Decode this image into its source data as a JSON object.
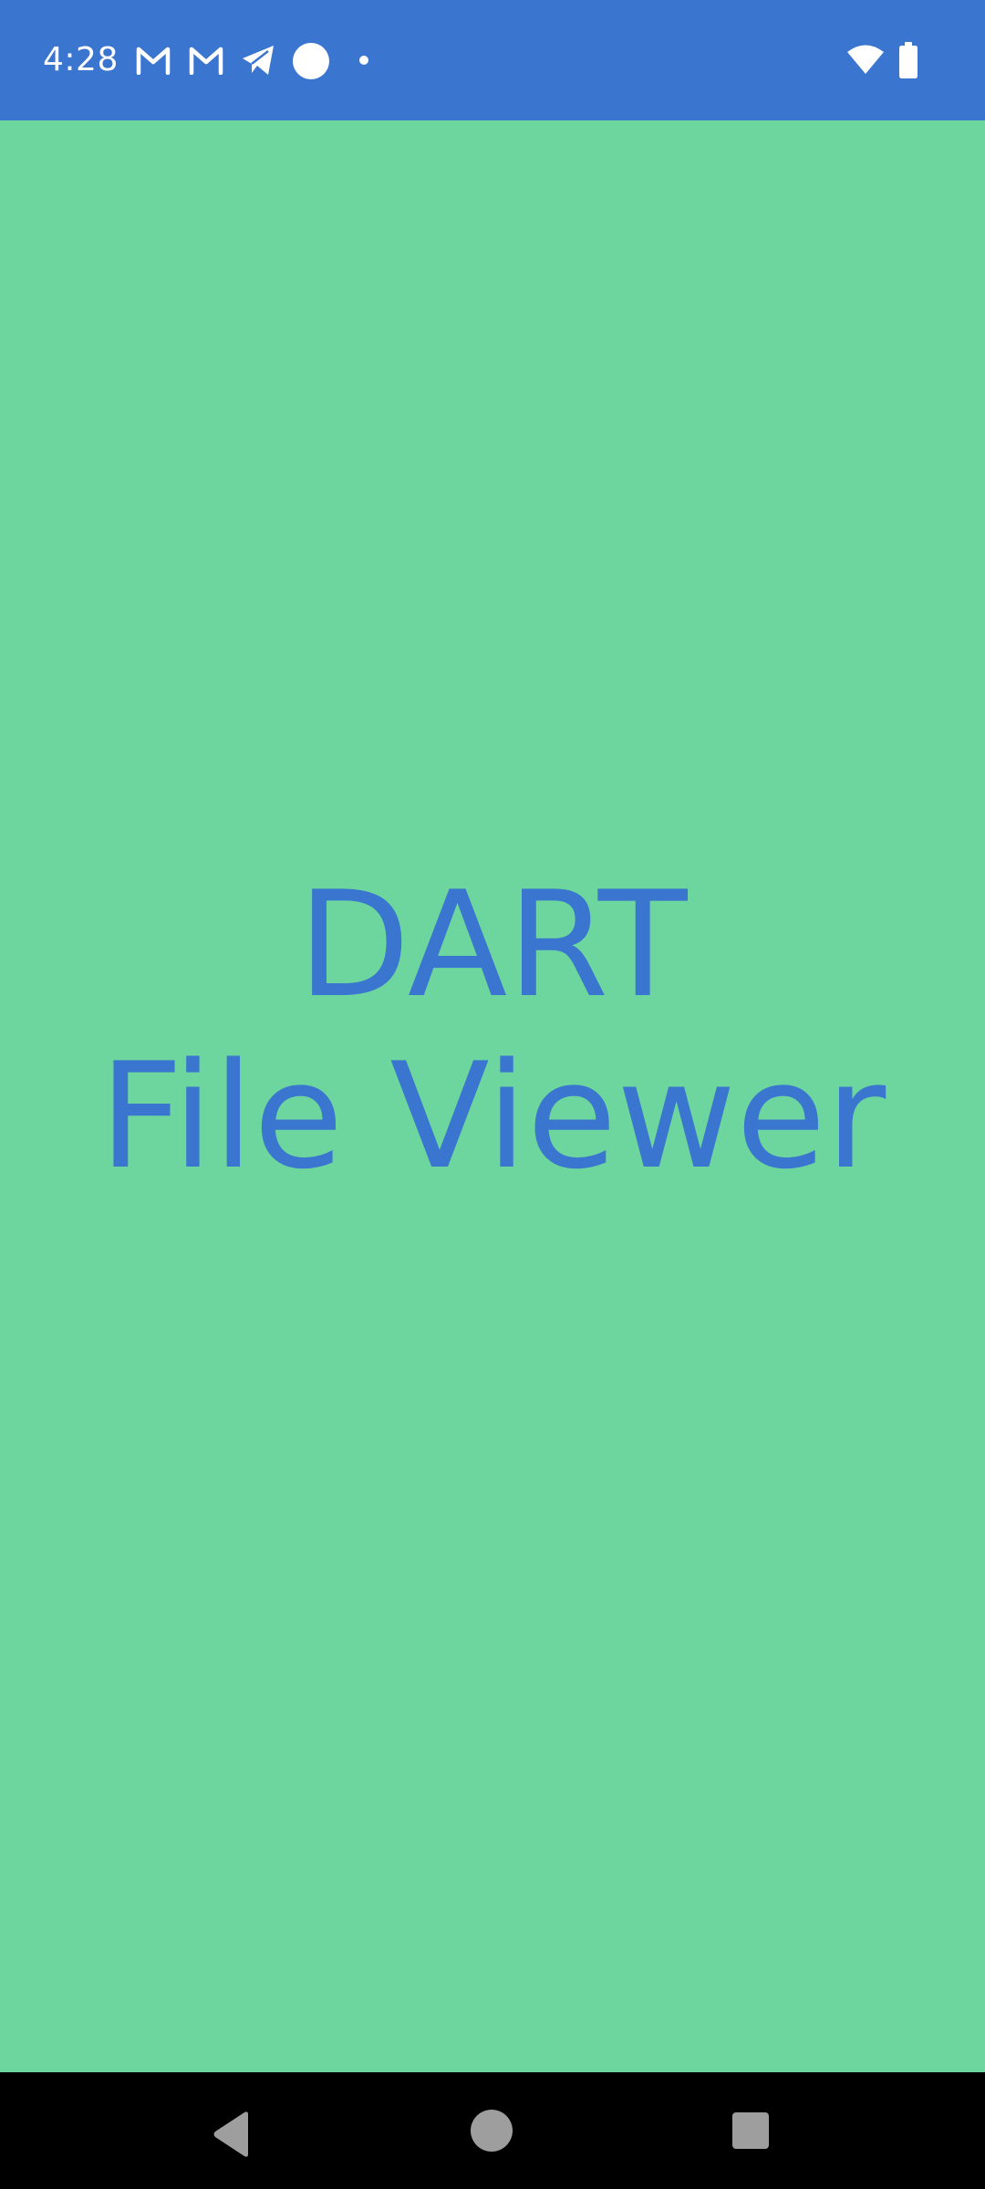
{
  "status_bar": {
    "time": "4:28",
    "background": "#3a75cf",
    "notification_icons": [
      "gmail-icon",
      "gmail-icon",
      "telegram-icon",
      "circle-app-icon",
      "more-notifications-dot-icon"
    ],
    "system_icons": [
      "wifi-icon",
      "battery-icon"
    ]
  },
  "splash": {
    "background": "#6dd69e",
    "text_color": "#3a75cf",
    "title_line1": "DART",
    "title_line2": "File Viewer"
  },
  "nav_bar": {
    "background": "#000000",
    "buttons": [
      "back-button",
      "home-button",
      "recents-button"
    ]
  }
}
